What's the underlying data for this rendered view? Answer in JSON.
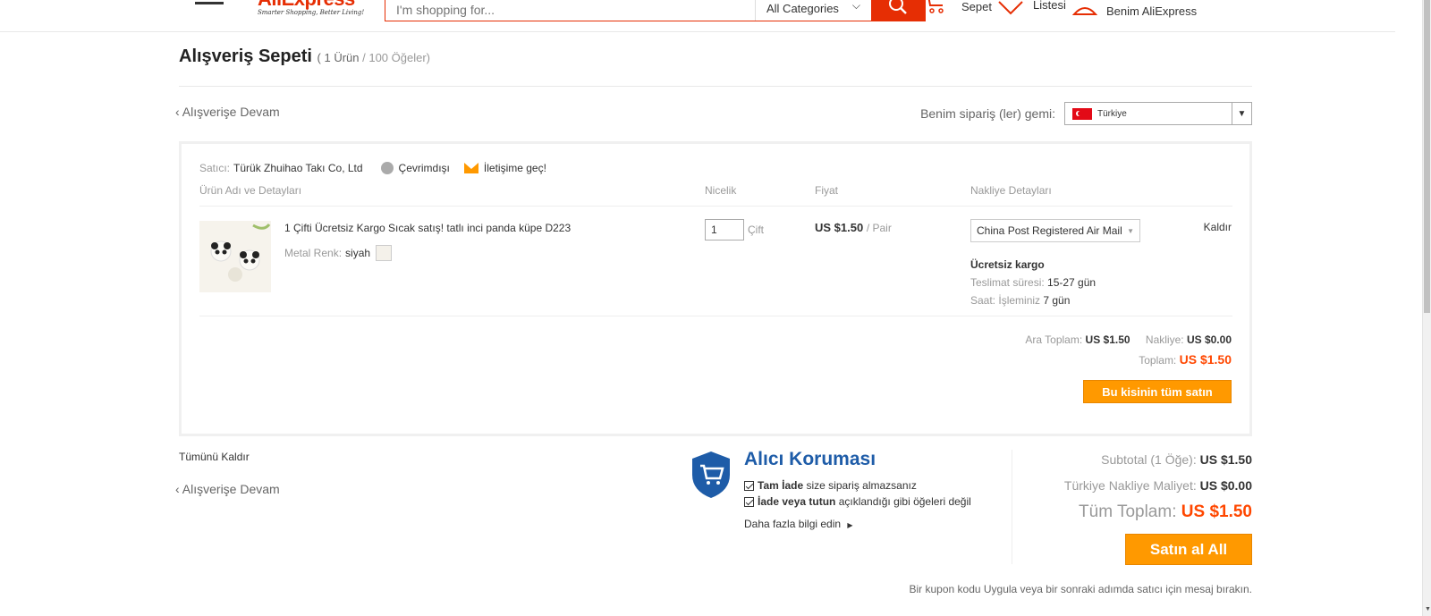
{
  "header": {
    "logo_text": "AliExpress",
    "tagline": "Smarter Shopping, Better Living!",
    "search_placeholder": "I'm shopping for...",
    "category": "All Categories",
    "cart_label": "Sepet",
    "wishlist_label": "Listesi",
    "account_label": "Benim AliExpress"
  },
  "page": {
    "title": "Alışveriş Sepeti",
    "count_products": "( 1 Ürün",
    "count_items": "/ 100 Öğeler)",
    "continue_shopping": "‹ Alışverişe Devam",
    "ship_to_label": "Benim sipariş (ler) gemi:",
    "ship_to_country": "Türkiye"
  },
  "cart": {
    "seller_label": "Satıcı:",
    "seller_name": "Türük Zhuihao Takı Co, Ltd",
    "seller_status": "Çevrimdışı",
    "contact": "İletişime geç!",
    "columns": {
      "product": "Ürün Adı ve Detayları",
      "quantity": "Nicelik",
      "price": "Fiyat",
      "shipping": "Nakliye Detayları"
    },
    "item": {
      "name": "1 Çifti Ücretsiz Kargo Sıcak satış! tatlı inci panda küpe D223",
      "attr_label": "Metal Renk:",
      "attr_value": "siyah",
      "quantity": "1",
      "unit": "Çift",
      "price": "US $1.50",
      "price_per": "/ Pair",
      "shipping_method": "China Post Registered Air Mail",
      "remove": "Kaldır",
      "free_shipping": "Ücretsiz kargo",
      "delivery_label": "Teslimat süresi:",
      "delivery_value": "15-27 gün",
      "processing_label": "Saat: İşleminiz",
      "processing_value": "7 gün"
    },
    "subtotal_label": "Ara Toplam:",
    "subtotal_value": "US $1.50",
    "shipping_label": "Nakliye:",
    "shipping_value": "US $0.00",
    "total_label": "Toplam:",
    "total_value": "US $1.50",
    "buy_seller_button": "Bu kisinin tüm satın"
  },
  "bottom": {
    "remove_all": "Tümünü Kaldır",
    "continue_shopping": "‹ Alışverişe Devam",
    "protection_title": "Alıcı Koruması",
    "protection_1_bold": "Tam İade",
    "protection_1_rest": "size sipariş almazsanız",
    "protection_2_bold": "İade veya tutun",
    "protection_2_rest": "açıklandığı gibi öğeleri değil",
    "learn_more": "Daha fazla bilgi edin",
    "subtotal_label": "Subtotal (1 Öğe):",
    "subtotal_value": "US $1.50",
    "shipping_label": "Türkiye Nakliye Maliyet:",
    "shipping_value": "US $0.00",
    "total_label": "Tüm Toplam:",
    "total_value": "US $1.50",
    "buy_all_button": "Satın al All",
    "coupon_note": "Bir kupon kodu Uygula veya bir sonraki adımda satıcı için mesaj bırakın."
  },
  "colors": {
    "brand": "#e62e04",
    "accent_orange": "#ff9900",
    "price_red": "#ff4700",
    "protection_blue": "#1e5ca8"
  }
}
